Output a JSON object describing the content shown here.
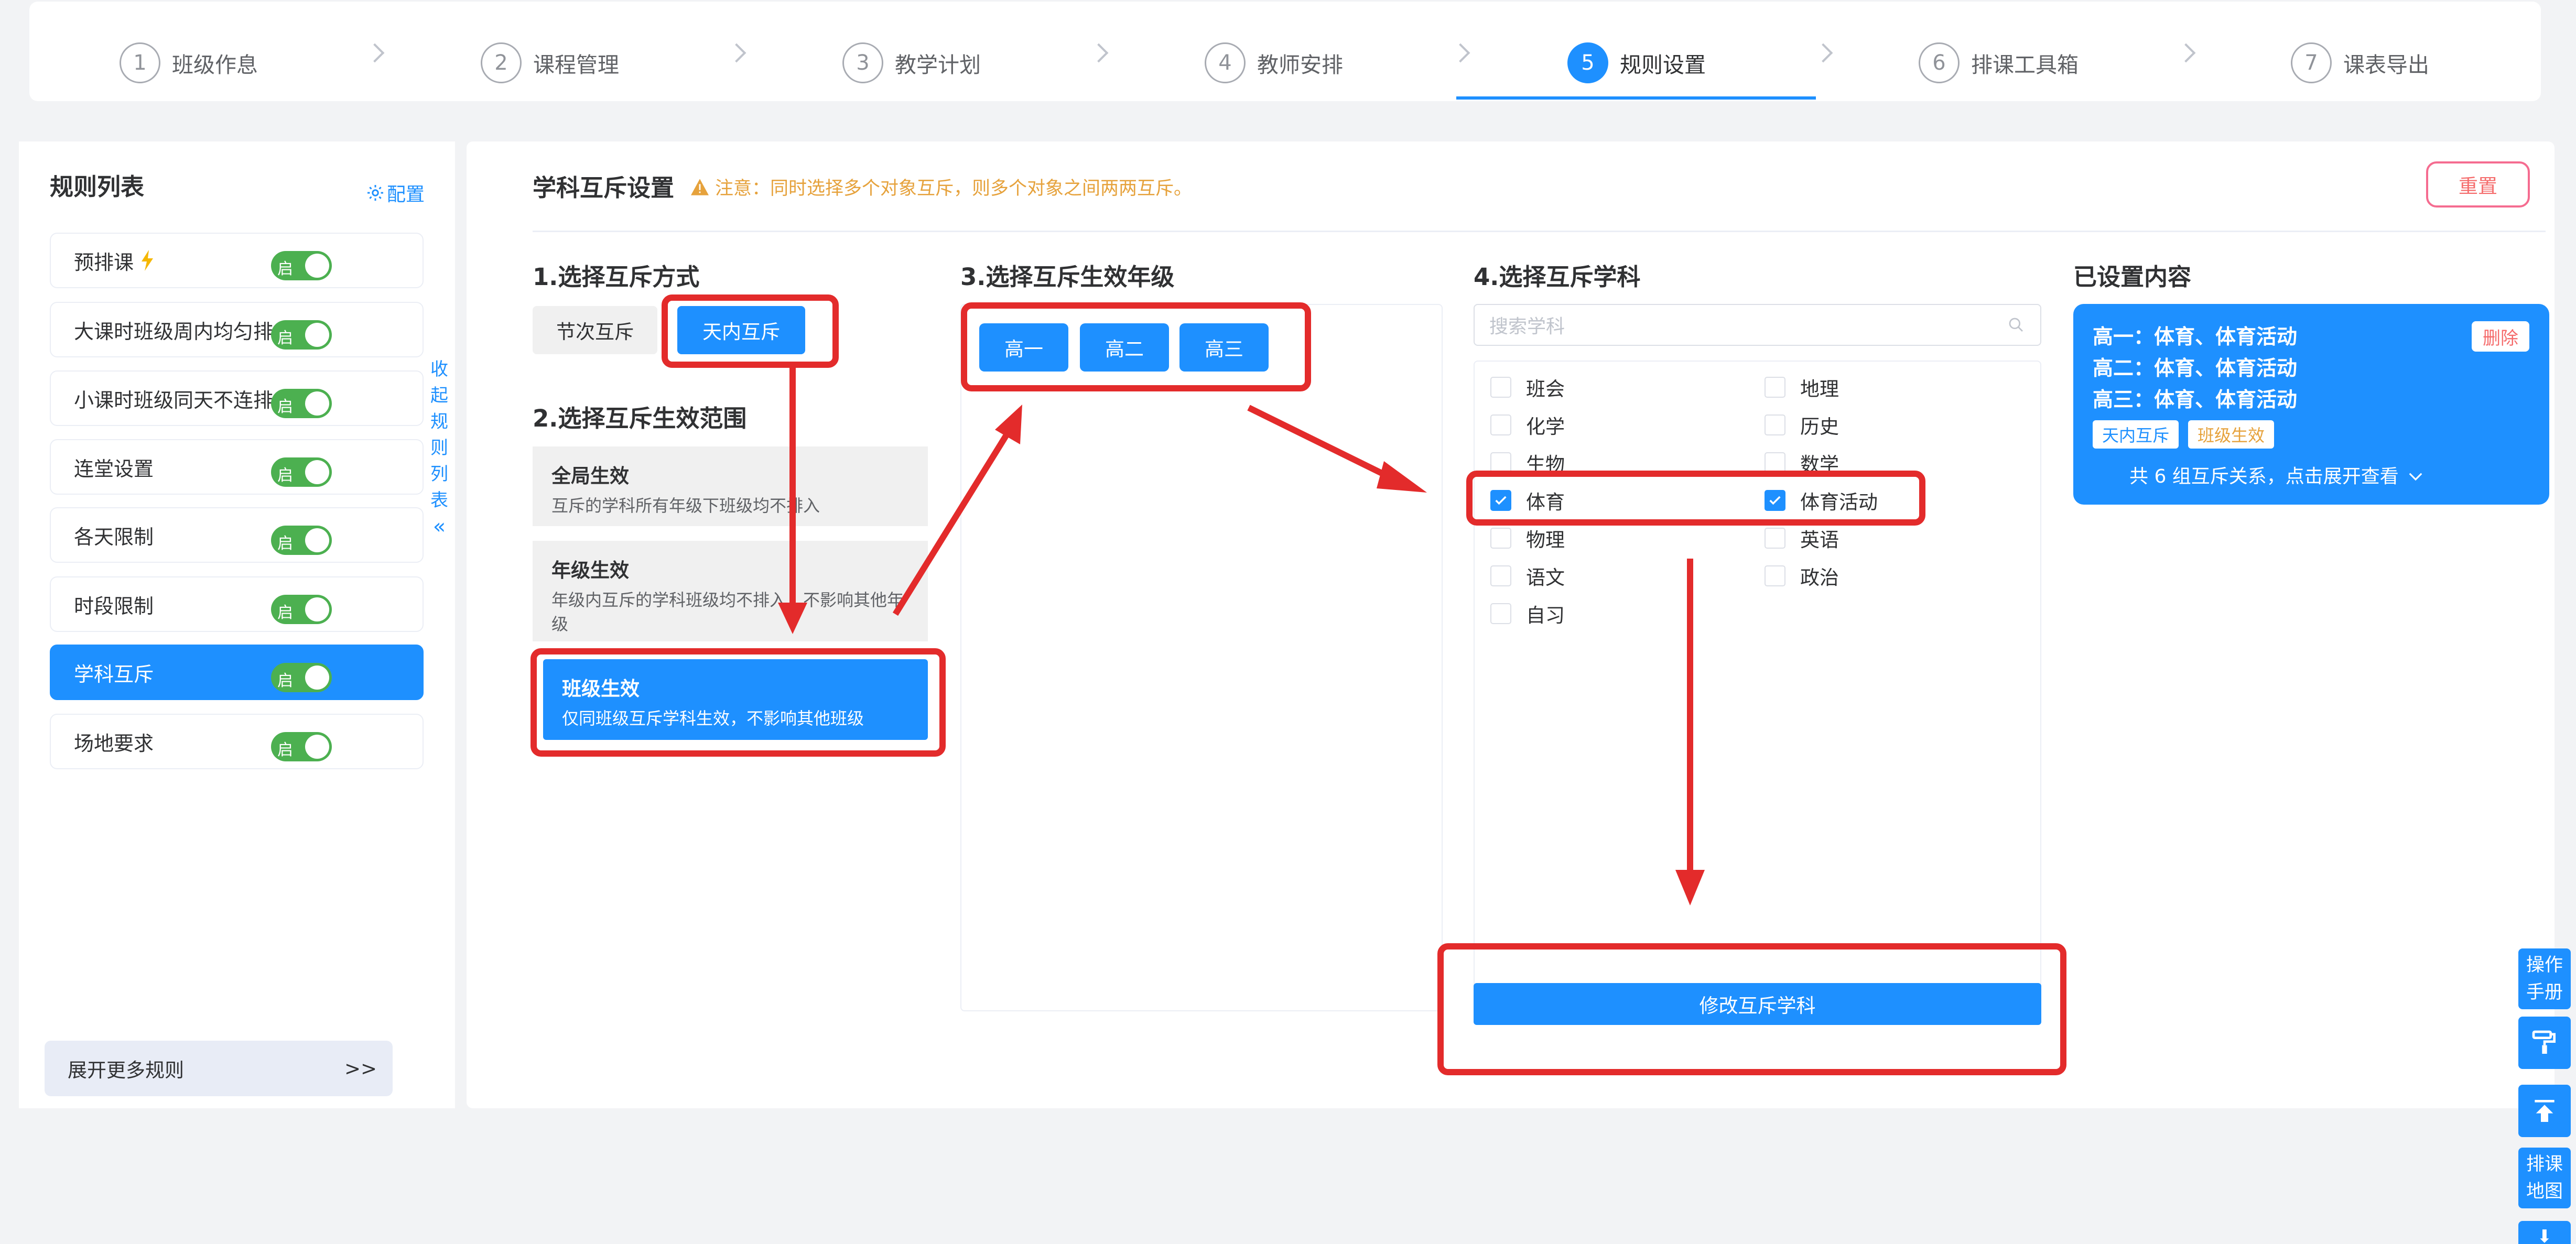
{
  "steps": [
    {
      "num": "1",
      "label": "班级作息"
    },
    {
      "num": "2",
      "label": "课程管理"
    },
    {
      "num": "3",
      "label": "教学计划"
    },
    {
      "num": "4",
      "label": "教师安排"
    },
    {
      "num": "5",
      "label": "规则设置",
      "active": true
    },
    {
      "num": "6",
      "label": "排课工具箱"
    },
    {
      "num": "7",
      "label": "课表导出"
    }
  ],
  "sidebar": {
    "title": "规则列表",
    "config_label": "配置",
    "toggle_label": "启",
    "rules": [
      {
        "label": "预排课",
        "icon": "lightning-icon"
      },
      {
        "label": "大课时班级周内均匀排"
      },
      {
        "label": "小课时班级同天不连排"
      },
      {
        "label": "连堂设置"
      },
      {
        "label": "各天限制"
      },
      {
        "label": "时段限制"
      },
      {
        "label": "学科互斥",
        "active": true
      },
      {
        "label": "场地要求"
      }
    ],
    "collapse_text": "收起规则列表",
    "collapse_icon": "double-chevron-left-icon",
    "expand_more_label": "展开更多规则",
    "expand_more_icon": ">>"
  },
  "main": {
    "title": "学科互斥设置",
    "warning": "注意：同时选择多个对象互斥，则多个对象之间两两互斥。",
    "reset_label": "重置",
    "section1": {
      "title": "1.选择互斥方式",
      "modes": [
        "节次互斥",
        "天内互斥"
      ],
      "selected_mode": "天内互斥"
    },
    "section2": {
      "title": "2.选择互斥生效范围",
      "scopes": [
        {
          "title": "全局生效",
          "desc": "互斥的学科所有年级下班级均不排入"
        },
        {
          "title": "年级生效",
          "desc": "年级内互斥的学科班级均不排入，不影响其他年级"
        },
        {
          "title": "班级生效",
          "desc": "仅同班级互斥学科生效，不影响其他班级",
          "active": true
        }
      ]
    },
    "section3": {
      "title": "3.选择互斥生效年级",
      "grades": [
        "高一",
        "高二",
        "高三"
      ]
    },
    "section4": {
      "title": "4.选择互斥学科",
      "search_placeholder": "搜索学科",
      "subjects": [
        {
          "label": "班会",
          "checked": false
        },
        {
          "label": "地理",
          "checked": false
        },
        {
          "label": "化学",
          "checked": false
        },
        {
          "label": "历史",
          "checked": false
        },
        {
          "label": "生物",
          "checked": false
        },
        {
          "label": "数学",
          "checked": false
        },
        {
          "label": "体育",
          "checked": true
        },
        {
          "label": "体育活动",
          "checked": true
        },
        {
          "label": "物理",
          "checked": false
        },
        {
          "label": "英语",
          "checked": false
        },
        {
          "label": "语文",
          "checked": false
        },
        {
          "label": "政治",
          "checked": false
        },
        {
          "label": "自习",
          "checked": false
        }
      ],
      "modify_label": "修改互斥学科"
    },
    "configured": {
      "title": "已设置内容",
      "lines": [
        "高一：体育、体育活动",
        "高二：体育、体育活动",
        "高三：体育、体育活动"
      ],
      "delete_label": "删除",
      "tags": [
        {
          "label": "天内互斥",
          "color": "#1e90ff"
        },
        {
          "label": "班级生效",
          "color": "#e6a23c"
        }
      ],
      "summary": "共 6 组互斥关系，点击展开查看"
    }
  },
  "tools": [
    {
      "label": "操作手册"
    },
    {
      "icon": "paint-roller-icon"
    },
    {
      "icon": "back-to-top-icon"
    },
    {
      "label": "排课地图"
    }
  ],
  "colors": {
    "primary": "#1e90ff",
    "toggle_on": "#4cb050",
    "annotation_red": "#e32b2b",
    "warning": "#e6a23c",
    "danger": "#f56c6c"
  }
}
